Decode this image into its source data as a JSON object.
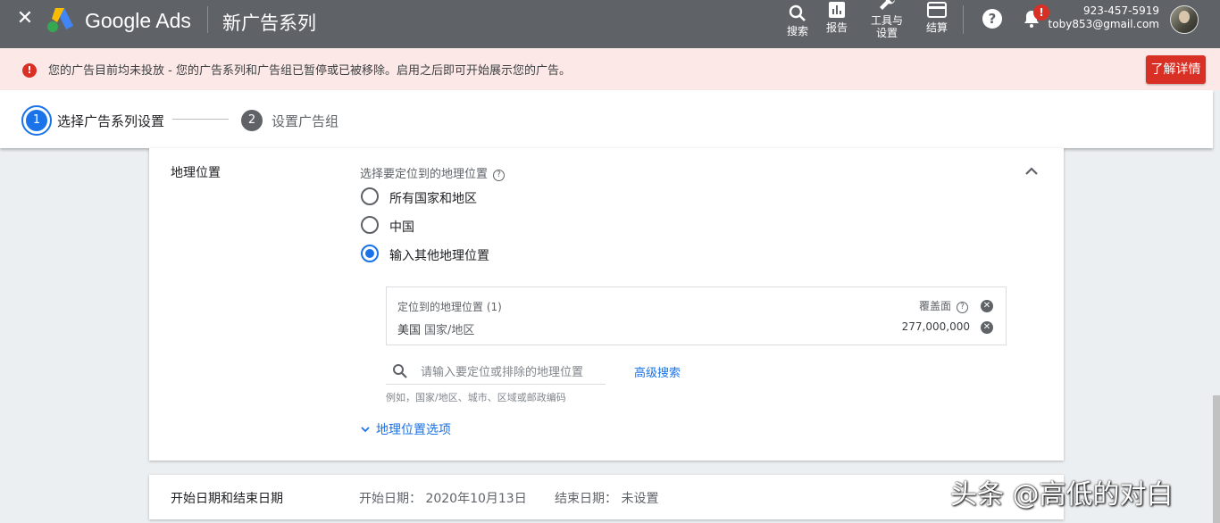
{
  "header": {
    "brand": "Google Ads",
    "title": "新广告系列",
    "tools": {
      "search": "搜索",
      "reports": "报告",
      "tools_line1": "工具与",
      "tools_line2": "设置",
      "billing": "结算"
    },
    "help": "?",
    "notification_badge": "!",
    "account_phone": "923-457-5919",
    "account_email": "toby853@gmail.com"
  },
  "alert": {
    "icon": "!",
    "text": "您的广告目前均未投放 - 您的广告系列和广告组已暂停或已被移除。启用之后即可开始展示您的广告。",
    "button": "了解详情"
  },
  "stepper": {
    "steps": [
      {
        "num": "1",
        "label": "选择广告系列设置",
        "active": true
      },
      {
        "num": "2",
        "label": "设置广告组",
        "active": false
      }
    ]
  },
  "location": {
    "section_title": "地理位置",
    "prompt": "选择要定位到的地理位置",
    "options": [
      "所有国家和地区",
      "中国",
      "输入其他地理位置"
    ],
    "selected": 2,
    "targeted_header": "定位到的地理位置 (1)",
    "coverage_label": "覆盖面",
    "targets": [
      {
        "name": "美国",
        "type": "国家/地区",
        "reach": "277,000,000"
      }
    ],
    "search_placeholder": "请输入要定位或排除的地理位置",
    "advanced_search": "高级搜索",
    "hint": "例如，国家/地区、城市、区域或邮政编码",
    "options_toggle": "地理位置选项"
  },
  "dates": {
    "title": "开始日期和结束日期",
    "start": "开始日期： 2020年10月13日",
    "end": "结束日期： 未设置"
  },
  "watermark": "头条 @高低的对白",
  "colors": {
    "topbar": "#5f6368",
    "accent": "#1a73e8",
    "error": "#d93025",
    "alert_bg": "#fce8e6"
  }
}
